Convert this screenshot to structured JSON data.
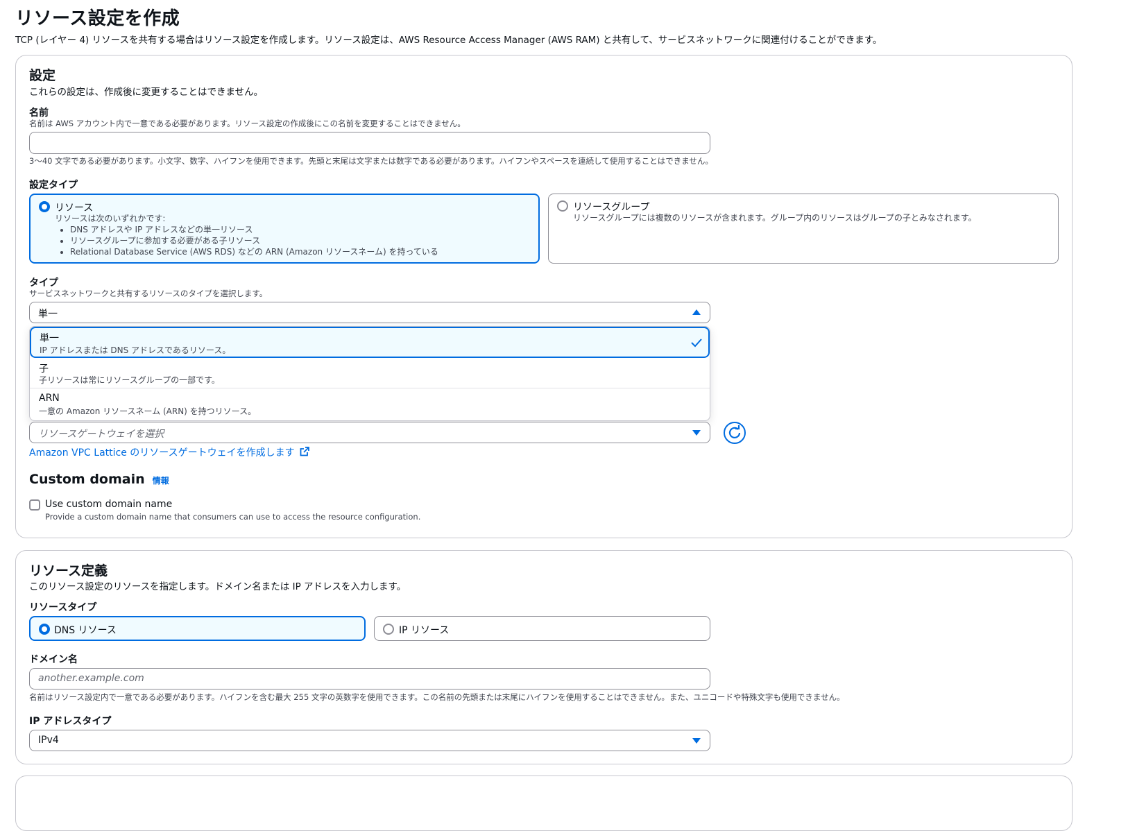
{
  "page": {
    "title": "リソース設定を作成",
    "description": "TCP (レイヤー 4) リソースを共有する場合はリソース設定を作成します。リソース設定は、AWS Resource Access Manager (AWS RAM) と共有して、サービスネットワークに関連付けることができます。"
  },
  "settings": {
    "heading": "設定",
    "subheading": "これらの設定は、作成後に変更することはできません。",
    "name": {
      "label": "名前",
      "description": "名前は AWS アカウント内で一意である必要があります。リソース設定の作成後にこの名前を変更することはできません。",
      "value": "",
      "constraint": "3～40 文字である必要があります。小文字、数字、ハイフンを使用できます。先頭と末尾は文字または数字である必要があります。ハイフンやスペースを連続して使用することはできません。"
    },
    "config_type": {
      "label": "設定タイプ",
      "resource": {
        "title": "リソース",
        "desc": "リソースは次のいずれかです:",
        "bullets": [
          "DNS アドレスや IP アドレスなどの単一リソース",
          "リソースグループに参加する必要がある子リソース",
          "Relational Database Service (AWS RDS) などの ARN (Amazon リソースネーム) を持っている"
        ]
      },
      "group": {
        "title": "リソースグループ",
        "desc": "リソースグループには複数のリソースが含まれます。グループ内のリソースはグループの子とみなされます。"
      }
    },
    "type": {
      "label": "タイプ",
      "description": "サービスネットワークと共有するリソースのタイプを選択します。",
      "selected": "単一",
      "options": [
        {
          "title": "単一",
          "desc": "IP アドレスまたは DNS アドレスであるリソース。"
        },
        {
          "title": "子",
          "desc": "子リソースは常にリソースグループの一部です。"
        },
        {
          "title": "ARN",
          "desc": "一意の Amazon リソースネーム (ARN) を持つリソース。"
        }
      ]
    },
    "gateway": {
      "placeholder": "リソースゲートウェイを選択",
      "create_link": "Amazon VPC Lattice のリソースゲートウェイを作成します"
    },
    "custom_domain": {
      "heading": "Custom domain",
      "info": "情報",
      "checkbox_label": "Use custom domain name",
      "checkbox_desc": "Provide a custom domain name that consumers can use to access the resource configuration."
    }
  },
  "definition": {
    "heading": "リソース定義",
    "subheading": "このリソース設定のリソースを指定します。ドメイン名または IP アドレスを入力します。",
    "resource_type": {
      "label": "リソースタイプ",
      "dns": "DNS リソース",
      "ip": "IP リソース"
    },
    "domain": {
      "label": "ドメイン名",
      "placeholder": "another.example.com",
      "constraint": "名前はリソース設定内で一意である必要があります。ハイフンを含む最大 255 文字の英数字を使用できます。この名前の先頭または末尾にハイフンを使用することはできません。また、ユニコードや特殊文字も使用できません。"
    },
    "ip_type": {
      "label": "IP アドレスタイプ",
      "value": "IPv4"
    }
  },
  "colors": {
    "accent": "#006ce0",
    "border": "#c6c6cd",
    "selected_bg": "#f0fbff"
  }
}
